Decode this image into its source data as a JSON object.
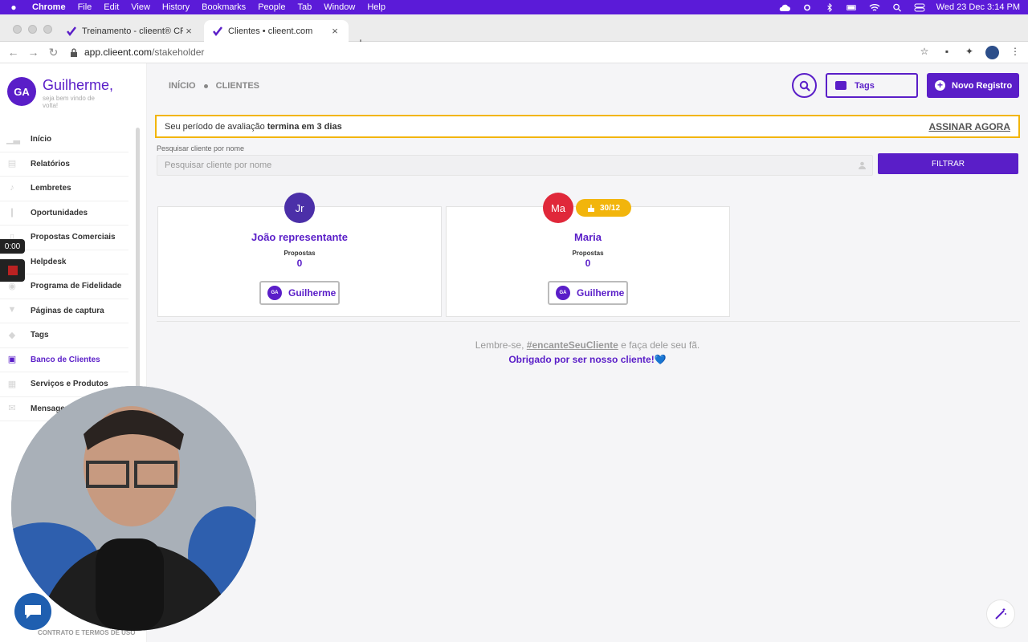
{
  "menubar": {
    "app": "Chrome",
    "items": [
      "File",
      "Edit",
      "View",
      "History",
      "Bookmarks",
      "People",
      "Tab",
      "Window",
      "Help"
    ],
    "clock": "Wed 23 Dec  3:14 PM"
  },
  "tabs": [
    {
      "label": "Treinamento - clieent® CRM"
    },
    {
      "label": "Clientes • clieent.com"
    }
  ],
  "address": {
    "host": "app.clieent.com",
    "path": "/stakeholder"
  },
  "user": {
    "initials": "GA",
    "name": "Guilherme,",
    "greeting": "seja bem vindo de volta!"
  },
  "sidebar": {
    "items": [
      {
        "label": "Início"
      },
      {
        "label": "Relatórios"
      },
      {
        "label": "Lembretes"
      },
      {
        "label": "Oportunidades"
      },
      {
        "label": "Propostas Comerciais"
      },
      {
        "label": "Helpdesk"
      },
      {
        "label": "Programa de Fidelidade"
      },
      {
        "label": "Páginas de captura"
      },
      {
        "label": "Tags"
      },
      {
        "label": "Banco de Clientes"
      },
      {
        "label": "Serviços e Produtos"
      },
      {
        "label": "Mensagens"
      }
    ],
    "footer": "CONTRATO E TERMOS DE USO"
  },
  "recording": {
    "timer": "0:00"
  },
  "breadcrumb": {
    "home": "INÍCIO",
    "current": "CLIENTES"
  },
  "header": {
    "tags_label": "Tags",
    "new_label": "Novo Registro"
  },
  "trial": {
    "text": "Seu período de avaliação",
    "bold": "termina em 3 dias",
    "cta": "ASSINAR AGORA"
  },
  "search": {
    "label": "Pesquisar cliente por nome",
    "placeholder": "Pesquisar cliente por nome",
    "button": "FILTRAR"
  },
  "clients": [
    {
      "initials": "Jr",
      "name": "João representante",
      "proposals_label": "Propostas",
      "proposals": "0",
      "owner_initials": "GA",
      "owner": "Guilherme",
      "avatar_color": "#4b2fa8"
    },
    {
      "initials": "Ma",
      "name": "Maria",
      "proposals_label": "Propostas",
      "proposals": "0",
      "owner_initials": "GA",
      "owner": "Guilherme",
      "avatar_color": "#e0283a",
      "badge": "30/12"
    }
  ],
  "footer": {
    "line1_pre": "Lembre-se,",
    "line1_tag": "#encanteSeuCliente",
    "line1_post": "e faça dele seu fã.",
    "line2": "Obrigado por ser nosso cliente!💙"
  },
  "colors": {
    "brand": "#5a1ec8",
    "accent": "#f2b50c",
    "menubar": "#5b1bd8"
  }
}
